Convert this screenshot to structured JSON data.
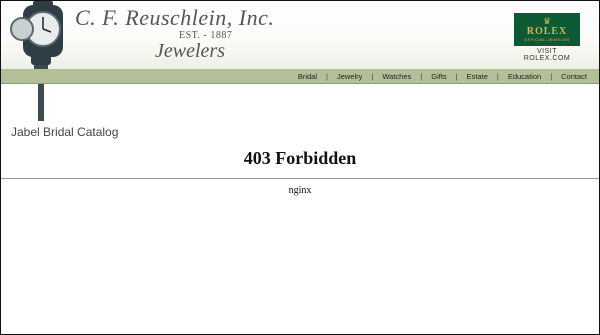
{
  "brand": {
    "name": "C. F. Reuschlein, Inc.",
    "established": "EST. - 1887",
    "tagline": "Jewelers"
  },
  "rolex": {
    "badge_name": "ROLEX",
    "badge_sub": "OFFICIAL JEWELER",
    "link_text": "VISIT ROLEX.COM"
  },
  "nav": {
    "items": [
      "Bridal",
      "Jewelry",
      "Watches",
      "Gifts",
      "Estate",
      "Education",
      "Contact"
    ]
  },
  "content": {
    "subheading": "Jabel Bridal Catalog",
    "error_title": "403 Forbidden",
    "server": "nginx"
  },
  "colors": {
    "nav_bar": "#b3bf97",
    "rolex_green": "#0b5a33",
    "rolex_gold": "#d4b45a"
  }
}
